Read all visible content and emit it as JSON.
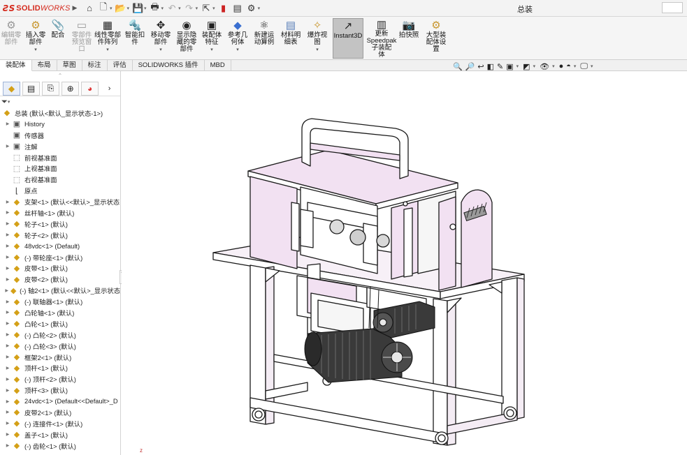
{
  "app": {
    "brand_mark": "ƧS",
    "brand_bold": "SOLID",
    "brand_italic": "WORKS",
    "document_title": "总装"
  },
  "ribbon": {
    "buttons": [
      {
        "id": "edit-component",
        "label1": "编辑零",
        "label2": "部件",
        "label3": "",
        "disabled": true,
        "dropdown": false,
        "icon": "edit-component-icon"
      },
      {
        "id": "insert-component",
        "label1": "插入零",
        "label2": "部件",
        "label3": "",
        "disabled": false,
        "dropdown": true,
        "icon": "insert-component-icon"
      },
      {
        "id": "mate",
        "label1": "配合",
        "label2": "",
        "label3": "",
        "disabled": false,
        "dropdown": false,
        "icon": "mate-icon"
      },
      {
        "id": "component-preview",
        "label1": "零部件",
        "label2": "预览窗",
        "label3": "口",
        "disabled": true,
        "dropdown": false,
        "icon": "preview-icon"
      },
      {
        "id": "linear-pattern",
        "label1": "线性零部",
        "label2": "件阵列",
        "label3": "",
        "disabled": false,
        "dropdown": true,
        "icon": "pattern-icon"
      },
      {
        "id": "smart-fastener",
        "label1": "智能扣",
        "label2": "件",
        "label3": "",
        "disabled": false,
        "dropdown": false,
        "icon": "fastener-icon"
      },
      {
        "id": "move-component",
        "label1": "移动零",
        "label2": "部件",
        "label3": "",
        "disabled": false,
        "dropdown": true,
        "icon": "move-icon"
      },
      {
        "id": "show-hidden",
        "label1": "显示隐",
        "label2": "藏的零",
        "label3": "部件",
        "disabled": false,
        "dropdown": false,
        "icon": "show-hidden-icon"
      },
      {
        "id": "assembly-feature",
        "label1": "装配体",
        "label2": "特征",
        "label3": "",
        "disabled": false,
        "dropdown": true,
        "icon": "assembly-feature-icon"
      },
      {
        "id": "reference-geometry",
        "label1": "参考几",
        "label2": "何体",
        "label3": "",
        "disabled": false,
        "dropdown": true,
        "icon": "reference-geometry-icon"
      },
      {
        "id": "new-motion-study",
        "label1": "新建运",
        "label2": "动算例",
        "label3": "",
        "disabled": false,
        "dropdown": false,
        "icon": "motion-icon"
      },
      {
        "id": "bom",
        "label1": "材料明",
        "label2": "细表",
        "label3": "",
        "disabled": false,
        "dropdown": false,
        "icon": "bom-icon"
      },
      {
        "id": "exploded-view",
        "label1": "爆炸视",
        "label2": "图",
        "label3": "",
        "disabled": false,
        "dropdown": true,
        "icon": "explode-icon"
      },
      {
        "id": "instant3d",
        "label1": "Instant3D",
        "label2": "",
        "label3": "",
        "disabled": false,
        "dropdown": false,
        "icon": "instant3d-icon",
        "active": true
      },
      {
        "id": "update-speedpak",
        "label1": "更新",
        "label2": "Speedpak",
        "label3": "子装配",
        "label4": "体",
        "disabled": false,
        "dropdown": false,
        "icon": "speedpak-icon"
      },
      {
        "id": "take-snapshot",
        "label1": "拍快照",
        "label2": "",
        "label3": "",
        "disabled": false,
        "dropdown": false,
        "icon": "camera-icon"
      },
      {
        "id": "large-assembly",
        "label1": "大型装",
        "label2": "配体设",
        "label3": "置",
        "disabled": false,
        "dropdown": false,
        "icon": "large-assembly-icon"
      }
    ]
  },
  "tabs": [
    "装配体",
    "布局",
    "草图",
    "标注",
    "评估",
    "SOLIDWORKS 插件",
    "MBD"
  ],
  "tree": {
    "root": "总装 (默认<默认_显示状态-1>)",
    "items": [
      {
        "label": "History",
        "icon": "history-icon",
        "expand": true,
        "kind": "folder"
      },
      {
        "label": "传感器",
        "icon": "sensor-icon",
        "expand": false,
        "kind": "folder"
      },
      {
        "label": "注解",
        "icon": "annotation-icon",
        "expand": true,
        "kind": "folder"
      },
      {
        "label": "前视基准面",
        "icon": "plane-icon",
        "expand": false,
        "kind": "plane"
      },
      {
        "label": "上视基准面",
        "icon": "plane-icon",
        "expand": false,
        "kind": "plane"
      },
      {
        "label": "右视基准面",
        "icon": "plane-icon",
        "expand": false,
        "kind": "plane"
      },
      {
        "label": "原点",
        "icon": "origin-icon",
        "expand": false,
        "kind": "origin"
      },
      {
        "label": "支架<1> (默认<<默认>_显示状态",
        "icon": "subassembly-icon",
        "expand": true,
        "kind": "asm"
      },
      {
        "label": "丝杆轴<1> (默认)",
        "icon": "part-icon",
        "expand": true,
        "kind": "part"
      },
      {
        "label": "轮子<1> (默认)",
        "icon": "part-icon",
        "expand": true,
        "kind": "part"
      },
      {
        "label": "轮子<2> (默认)",
        "icon": "part-icon",
        "expand": true,
        "kind": "part"
      },
      {
        "label": "48vdc<1> (Default)",
        "icon": "part-icon",
        "expand": true,
        "kind": "part"
      },
      {
        "label": "(-) 带轮座<1> (默认)",
        "icon": "part-icon",
        "expand": true,
        "kind": "part"
      },
      {
        "label": "皮带<1> (默认)",
        "icon": "part-icon",
        "expand": true,
        "kind": "part"
      },
      {
        "label": "皮带<2> (默认)",
        "icon": "part-icon",
        "expand": true,
        "kind": "part"
      },
      {
        "label": "(-) 轴2<1> (默认<<默认>_显示状态",
        "icon": "subassembly-icon",
        "expand": true,
        "kind": "asm"
      },
      {
        "label": "(-) 联轴器<1> (默认)",
        "icon": "part-icon",
        "expand": true,
        "kind": "part"
      },
      {
        "label": "凸轮轴<1> (默认)",
        "icon": "part-icon",
        "expand": true,
        "kind": "part"
      },
      {
        "label": "凸轮<1> (默认)",
        "icon": "part-icon",
        "expand": true,
        "kind": "part"
      },
      {
        "label": "(-) 凸轮<2> (默认)",
        "icon": "part-icon",
        "expand": true,
        "kind": "part"
      },
      {
        "label": "(-) 凸轮<3> (默认)",
        "icon": "part-icon",
        "expand": true,
        "kind": "part"
      },
      {
        "label": "框架2<1> (默认)",
        "icon": "part-icon",
        "expand": true,
        "kind": "part"
      },
      {
        "label": "顶杆<1> (默认)",
        "icon": "part-icon",
        "expand": true,
        "kind": "part"
      },
      {
        "label": "(-) 顶杆<2> (默认)",
        "icon": "part-icon",
        "expand": true,
        "kind": "part"
      },
      {
        "label": "顶杆<3> (默认)",
        "icon": "part-icon",
        "expand": true,
        "kind": "part"
      },
      {
        "label": "24vdc<1> (Default<<Default>_D",
        "icon": "subassembly-icon",
        "expand": true,
        "kind": "asm"
      },
      {
        "label": "皮带2<1> (默认)",
        "icon": "part-icon",
        "expand": true,
        "kind": "part"
      },
      {
        "label": "(-) 连接件<1> (默认)",
        "icon": "part-icon",
        "expand": true,
        "kind": "part"
      },
      {
        "label": "盖子<1> (默认)",
        "icon": "part-icon",
        "expand": true,
        "kind": "part"
      },
      {
        "label": "(-) 齿轮<1> (默认)",
        "icon": "part-icon",
        "expand": true,
        "kind": "part"
      }
    ]
  },
  "viewport": {
    "axis_z": "z"
  },
  "colors": {
    "brand": "#d52b1e",
    "part_fill": "#f2e1f2",
    "part_edge": "#1a1a1a",
    "motor": "#3a3a3a"
  }
}
